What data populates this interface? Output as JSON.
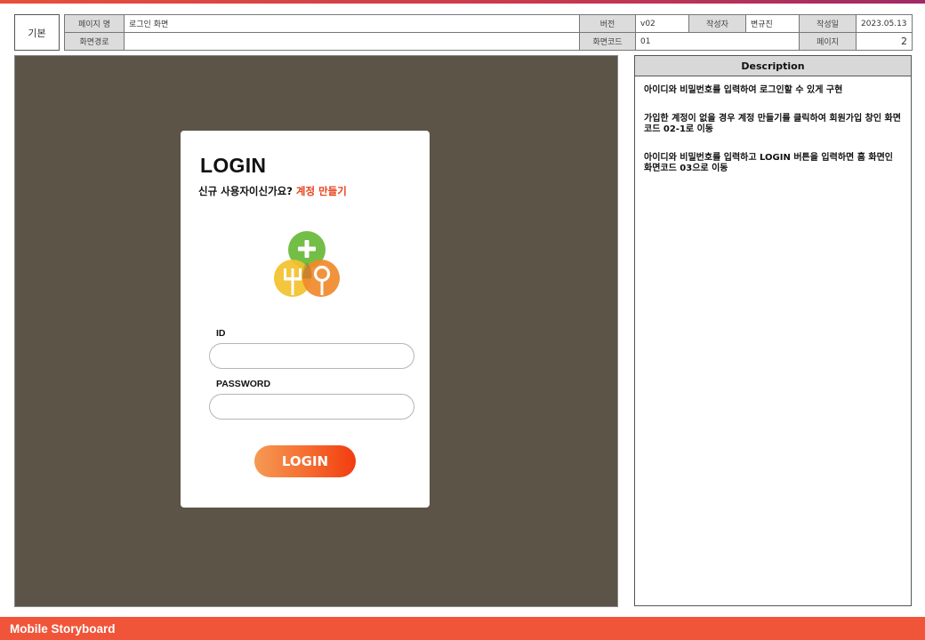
{
  "header": {
    "basic": "기본",
    "page_name_label": "페이지 명",
    "page_name": "로그인 화면",
    "version_label": "버전",
    "version": "v02",
    "author_label": "작성자",
    "author": "변규진",
    "date_label": "작성일",
    "date": "2023.05.13",
    "path_label": "화면경로",
    "path": "",
    "code_label": "화면코드",
    "code": "01",
    "page_label": "페이지",
    "page": "2"
  },
  "login": {
    "title": "LOGIN",
    "signup_question": "신규 사용자이신가요? ",
    "signup_link": "계정 만들기",
    "logo_icon": "fork-spoon-plus-logo-icon",
    "id_label": "ID",
    "id_value": "",
    "password_label": "PASSWORD",
    "password_value": "",
    "button": "LOGIN"
  },
  "description": {
    "title": "Description",
    "items": [
      "아이디와 비밀번호를 입력하여 로그인할 수 있게 구현",
      "가입한 계정이 없을 경우 계정 만들기를 클릭하여 회원가입 창인 화면코드 02-1로 이동",
      "아이디와 비밀번호를 입력하고 LOGIN 버튼을 입력하면 홈 화면인 화면코드 03으로 이동"
    ]
  },
  "footer": {
    "title": "Mobile Storyboard"
  },
  "colors": {
    "canvas": "#5c5447",
    "accent": "#f0553a",
    "link": "#e8421e",
    "logo_green": "#6cbb3c",
    "logo_yellow": "#f2c12e",
    "logo_orange": "#f08a2c"
  }
}
